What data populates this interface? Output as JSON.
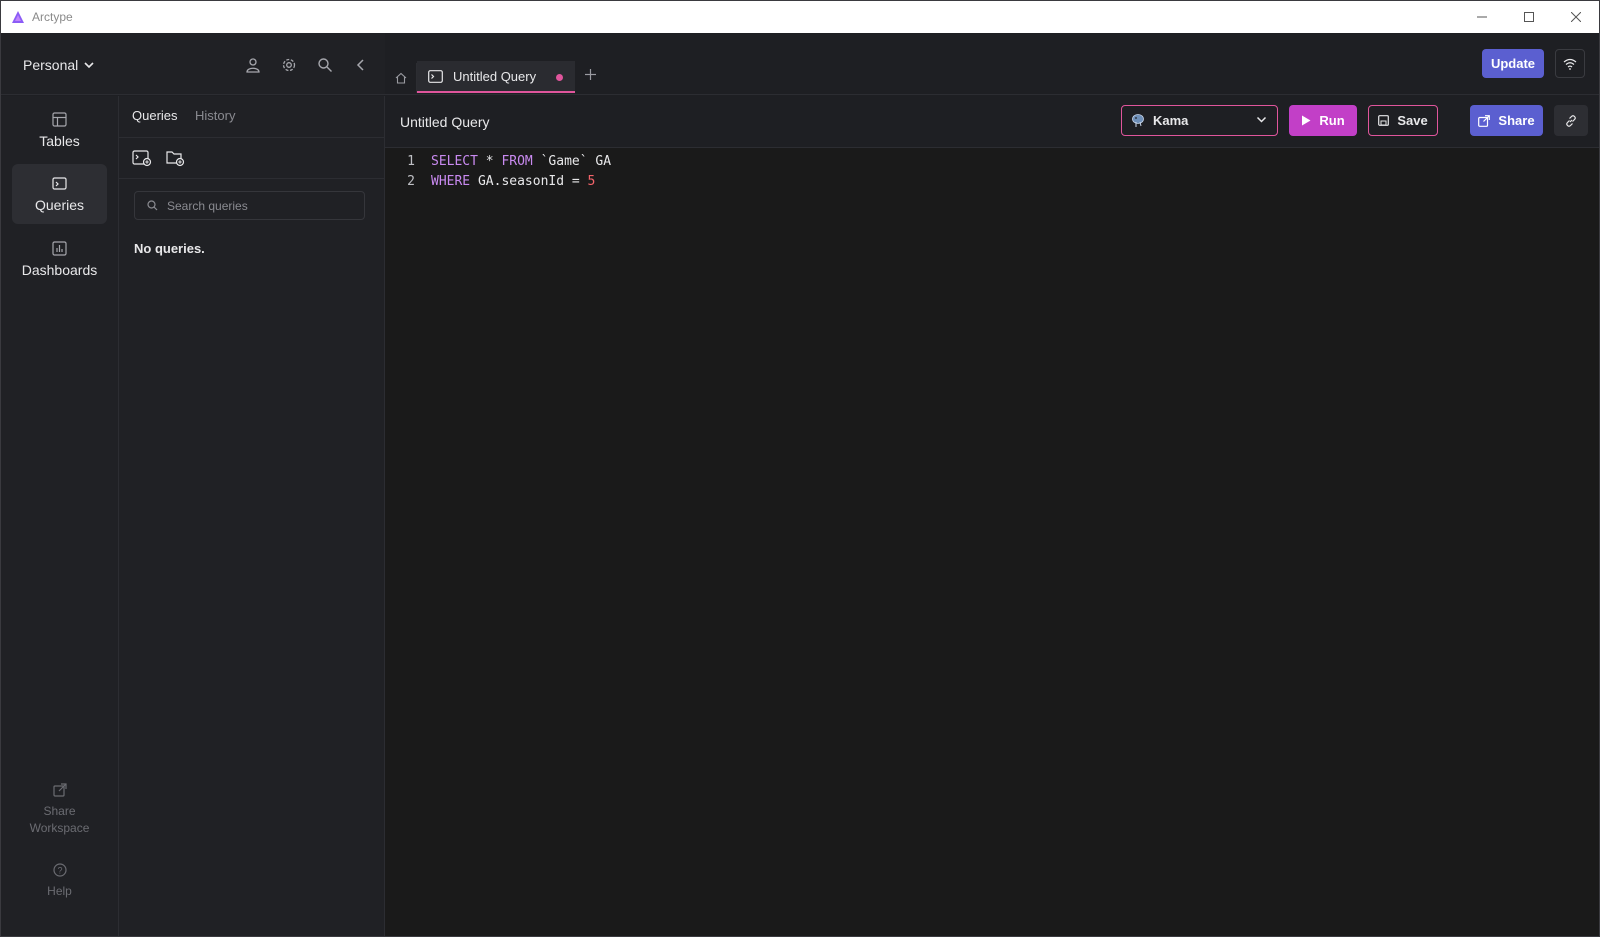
{
  "window": {
    "title": "Arctype",
    "controls": [
      "minimize",
      "maximize",
      "close"
    ]
  },
  "workspace": {
    "name": "Personal"
  },
  "nav": {
    "items": [
      {
        "label": "Tables",
        "icon": "table-icon",
        "active": false
      },
      {
        "label": "Queries",
        "icon": "terminal-icon",
        "active": true
      },
      {
        "label": "Dashboards",
        "icon": "chart-icon",
        "active": false
      }
    ],
    "bottom": [
      {
        "label": "Share Workspace",
        "icon": "external-link-icon"
      },
      {
        "label": "Help",
        "icon": "help-icon"
      }
    ]
  },
  "panel": {
    "tabs": [
      "Queries",
      "History"
    ],
    "search_placeholder": "Search queries",
    "empty_text": "No queries."
  },
  "tabs": {
    "query_tab_label": "Untitled Query",
    "update_label": "Update"
  },
  "toolbar": {
    "query_title": "Untitled Query",
    "database": "Kama",
    "run_label": "Run",
    "save_label": "Save",
    "share_label": "Share"
  },
  "editor": {
    "lines": [
      {
        "number": "1",
        "tokens": [
          {
            "t": "SELECT",
            "c": "kw"
          },
          {
            "t": " * ",
            "c": "op"
          },
          {
            "t": "FROM",
            "c": "kw"
          },
          {
            "t": " `Game` GA",
            "c": "txt"
          }
        ]
      },
      {
        "number": "2",
        "tokens": [
          {
            "t": "WHERE",
            "c": "kw"
          },
          {
            "t": " GA.seasonId = ",
            "c": "txt"
          },
          {
            "t": "5",
            "c": "num"
          }
        ]
      }
    ]
  },
  "colors": {
    "accent_pink": "#e0559c",
    "accent_blue": "#5b5fd0",
    "run_purple": "#c23fc7"
  }
}
